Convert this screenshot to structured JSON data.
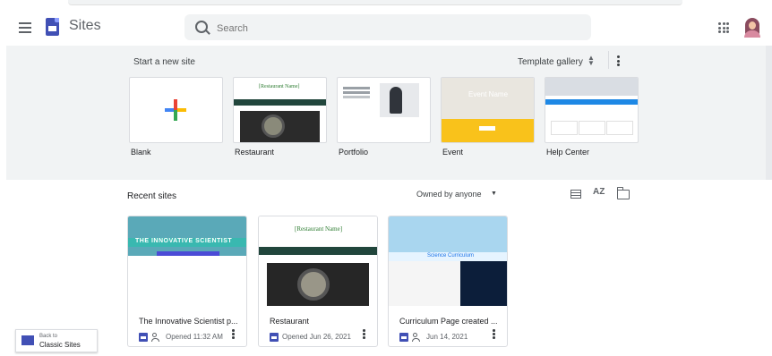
{
  "app": {
    "title": "Sites"
  },
  "search": {
    "placeholder": "Search"
  },
  "templates": {
    "heading": "Start a new site",
    "gallery_label": "Template gallery",
    "items": [
      {
        "label": "Blank",
        "restaurant_title": ""
      },
      {
        "label": "Restaurant",
        "restaurant_title": "[Restaurant Name]"
      },
      {
        "label": "Portfolio",
        "restaurant_title": ""
      },
      {
        "label": "Event",
        "event_title": "Event Name"
      },
      {
        "label": "Help Center",
        "restaurant_title": ""
      }
    ]
  },
  "recent": {
    "heading": "Recent sites",
    "owner_filter": "Owned by anyone",
    "sort_icon_label": "AZ",
    "sites": [
      {
        "name": "The Innovative Scientist p...",
        "meta": "Opened 11:32 AM",
        "thumb_title": "THE INNOVATIVE SCIENTIST"
      },
      {
        "name": "Restaurant",
        "meta": "Opened Jun 26, 2021",
        "thumb_title": "[Restaurant Name]"
      },
      {
        "name": "Curriculum Page created ...",
        "meta": "Jun 14, 2021",
        "thumb_title": "Science Curriculum"
      }
    ]
  },
  "classic": {
    "line1": "Back to",
    "line2": "Classic Sites"
  },
  "colors": {
    "accent": "#4150b5",
    "template_bg": "#f1f3f4"
  }
}
